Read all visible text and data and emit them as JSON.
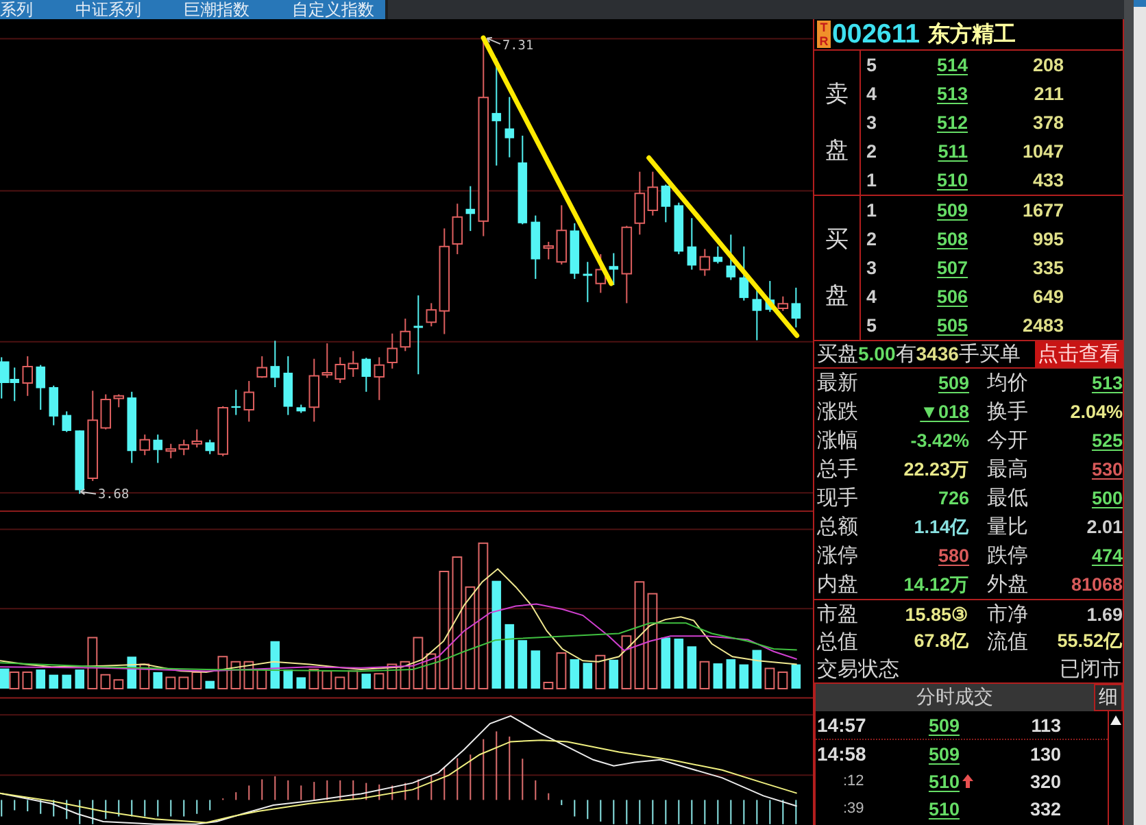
{
  "tabs": [
    {
      "label": "系列",
      "selected": false
    },
    {
      "label": "中证系列",
      "selected": false
    },
    {
      "label": "巨潮指数",
      "selected": false
    },
    {
      "label": "自定义指数",
      "selected": false
    }
  ],
  "price_chart": {
    "high_marker": "7.31",
    "low_marker": "3.68"
  },
  "quote": {
    "badge": "TR",
    "code": "002611",
    "name": "东方精工"
  },
  "order_book": {
    "sell": {
      "label": "卖盘",
      "rows": [
        {
          "rank": "5",
          "price": "514",
          "volume": "208"
        },
        {
          "rank": "4",
          "price": "513",
          "volume": "211"
        },
        {
          "rank": "3",
          "price": "512",
          "volume": "378"
        },
        {
          "rank": "2",
          "price": "511",
          "volume": "1047"
        },
        {
          "rank": "1",
          "price": "510",
          "volume": "433"
        }
      ]
    },
    "buy": {
      "label": "买盘",
      "rows": [
        {
          "rank": "1",
          "price": "509",
          "volume": "1677"
        },
        {
          "rank": "2",
          "price": "508",
          "volume": "995"
        },
        {
          "rank": "3",
          "price": "507",
          "volume": "335"
        },
        {
          "rank": "4",
          "price": "506",
          "volume": "649"
        },
        {
          "rank": "5",
          "price": "505",
          "volume": "2483"
        }
      ]
    }
  },
  "big_order": {
    "segments": [
      {
        "text": "买盘",
        "kind": "label"
      },
      {
        "text": "5.00",
        "kind": "price"
      },
      {
        "text": "有",
        "kind": "label"
      },
      {
        "text": "3436",
        "kind": "volume"
      },
      {
        "text": "手买单",
        "kind": "label"
      }
    ],
    "button": "点击查看"
  },
  "stats": {
    "rows": [
      {
        "cells": [
          {
            "label": "最新",
            "value": "509",
            "color": "#66dd66",
            "kind": "price"
          },
          {
            "label": "均价",
            "value": "513",
            "color": "#66dd66",
            "kind": "price"
          }
        ]
      },
      {
        "cells": [
          {
            "label": "涨跌",
            "value": "▼018",
            "color": "#66dd66",
            "kind": "price"
          },
          {
            "label": "换手",
            "value": "2.04%",
            "color": "#e8e88a",
            "kind": "figure"
          }
        ]
      },
      {
        "cells": [
          {
            "label": "涨幅",
            "value": "-3.42%",
            "color": "#66dd66",
            "kind": "figure"
          },
          {
            "label": "今开",
            "value": "525",
            "color": "#66dd66",
            "kind": "price"
          }
        ]
      },
      {
        "cells": [
          {
            "label": "总手",
            "value": "22.23万",
            "color": "#e8e88a",
            "kind": "figure"
          },
          {
            "label": "最高",
            "value": "530",
            "color": "#d85a5a",
            "kind": "price"
          }
        ]
      },
      {
        "cells": [
          {
            "label": "现手",
            "value": "726",
            "color": "#66dd66",
            "kind": "figure"
          },
          {
            "label": "最低",
            "value": "500",
            "color": "#66dd66",
            "kind": "price"
          }
        ]
      },
      {
        "cells": [
          {
            "label": "总额",
            "value": "1.14亿",
            "color": "#88e0e0",
            "kind": "figure"
          },
          {
            "label": "量比",
            "value": "2.01",
            "color": "#cfcfcf",
            "kind": "figure"
          }
        ]
      },
      {
        "cells": [
          {
            "label": "涨停",
            "value": "580",
            "color": "#d85a5a",
            "kind": "price"
          },
          {
            "label": "跌停",
            "value": "474",
            "color": "#66dd66",
            "kind": "price"
          }
        ]
      },
      {
        "cells": [
          {
            "label": "内盘",
            "value": "14.12万",
            "color": "#66dd66",
            "kind": "figure"
          },
          {
            "label": "外盘",
            "value": "81068",
            "color": "#d85a5a",
            "kind": "figure"
          }
        ]
      }
    ]
  },
  "valuation": {
    "rows": [
      {
        "cells": [
          {
            "label": "市盈",
            "value": "15.85③",
            "color": "#e8e88a",
            "kind": "figure"
          },
          {
            "label": "市净",
            "value": "1.69",
            "color": "#cfcfcf",
            "kind": "figure"
          }
        ]
      },
      {
        "cells": [
          {
            "label": "总值",
            "value": "67.8亿",
            "color": "#e8e88a",
            "kind": "figure"
          },
          {
            "label": "流值",
            "value": "55.52亿",
            "color": "#e8e88a",
            "kind": "figure"
          }
        ]
      }
    ],
    "status": {
      "label": "交易状态",
      "value": "已闭市"
    }
  },
  "trades": {
    "title": "分时成交",
    "detail_button": "细",
    "rows": [
      {
        "time": "14:57",
        "kind": "minute",
        "price": "509",
        "volume": "113",
        "up_arrow": false
      },
      {
        "time": "14:58",
        "kind": "minute",
        "price": "509",
        "volume": "130",
        "up_arrow": false
      },
      {
        "time": ":12",
        "kind": "second",
        "price": "510",
        "volume": "320",
        "up_arrow": true
      },
      {
        "time": ":39",
        "kind": "second",
        "price": "510",
        "volume": "332",
        "up_arrow": false
      }
    ]
  }
}
